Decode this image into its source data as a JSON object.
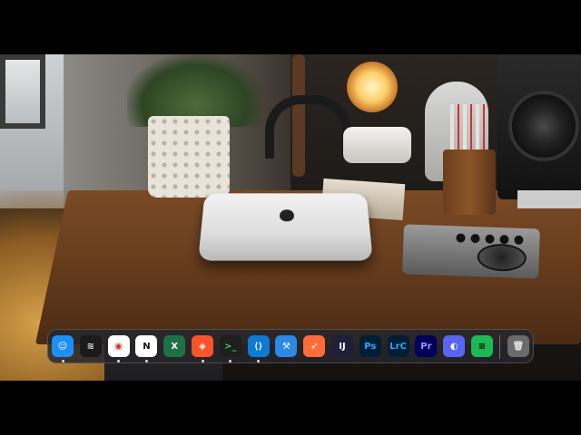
{
  "dock": {
    "items": [
      {
        "app": "Finder",
        "glyph": "☺",
        "icon": "finder-icon",
        "bg": "#1e8ff5",
        "fg": "#ffffff",
        "running": true
      },
      {
        "app": "Buffer",
        "glyph": "≋",
        "icon": "stack-icon",
        "bg": "#1a1a1a",
        "fg": "#e8e8e8",
        "running": false
      },
      {
        "app": "Google Chrome",
        "glyph": "◉",
        "icon": "chrome-icon",
        "bg": "#ffffff",
        "fg": "#d93025",
        "running": true
      },
      {
        "app": "Notion",
        "glyph": "N",
        "icon": "notion-icon",
        "bg": "#ffffff",
        "fg": "#111111",
        "running": true
      },
      {
        "app": "Microsoft Excel",
        "glyph": "X",
        "icon": "excel-icon",
        "bg": "#1e7145",
        "fg": "#ffffff",
        "running": false
      },
      {
        "app": "Brave",
        "glyph": "◈",
        "icon": "brave-icon",
        "bg": "#fb542b",
        "fg": "#ffffff",
        "running": true
      },
      {
        "app": "Terminal",
        "glyph": ">_",
        "icon": "terminal-icon",
        "bg": "#1e1e1e",
        "fg": "#39d353",
        "running": true
      },
      {
        "app": "Visual Studio Code",
        "glyph": "⟨⟩",
        "icon": "vscode-icon",
        "bg": "#0f7ad2",
        "fg": "#ffffff",
        "running": true
      },
      {
        "app": "Xcode",
        "glyph": "⚒",
        "icon": "xcode-icon",
        "bg": "#2b8ae6",
        "fg": "#ffffff",
        "running": false
      },
      {
        "app": "Postman",
        "glyph": "➶",
        "icon": "postman-icon",
        "bg": "#ff6c37",
        "fg": "#ffffff",
        "running": false
      },
      {
        "app": "IntelliJ IDEA",
        "glyph": "IJ",
        "icon": "intellij-icon",
        "bg": "#1f1f3a",
        "fg": "#ffffff",
        "running": false
      },
      {
        "app": "Photoshop",
        "glyph": "Ps",
        "icon": "photoshop-icon",
        "bg": "#001e36",
        "fg": "#31a8ff",
        "running": false
      },
      {
        "app": "Lightroom Classic",
        "glyph": "LrC",
        "icon": "lightroom-icon",
        "bg": "#001e36",
        "fg": "#31a8ff",
        "running": false
      },
      {
        "app": "Premiere Pro",
        "glyph": "Pr",
        "icon": "premiere-icon",
        "bg": "#00005b",
        "fg": "#9999ff",
        "running": false
      },
      {
        "app": "Discord",
        "glyph": "◐",
        "icon": "discord-icon",
        "bg": "#5865f2",
        "fg": "#ffffff",
        "running": false
      },
      {
        "app": "Spotify",
        "glyph": "≋",
        "icon": "spotify-icon",
        "bg": "#1db954",
        "fg": "#000000",
        "running": false
      }
    ],
    "trash": {
      "app": "Trash",
      "glyph": "🗑",
      "icon": "trash-icon",
      "bg": "#6b6b6b",
      "fg": "#e0e0e0"
    }
  }
}
